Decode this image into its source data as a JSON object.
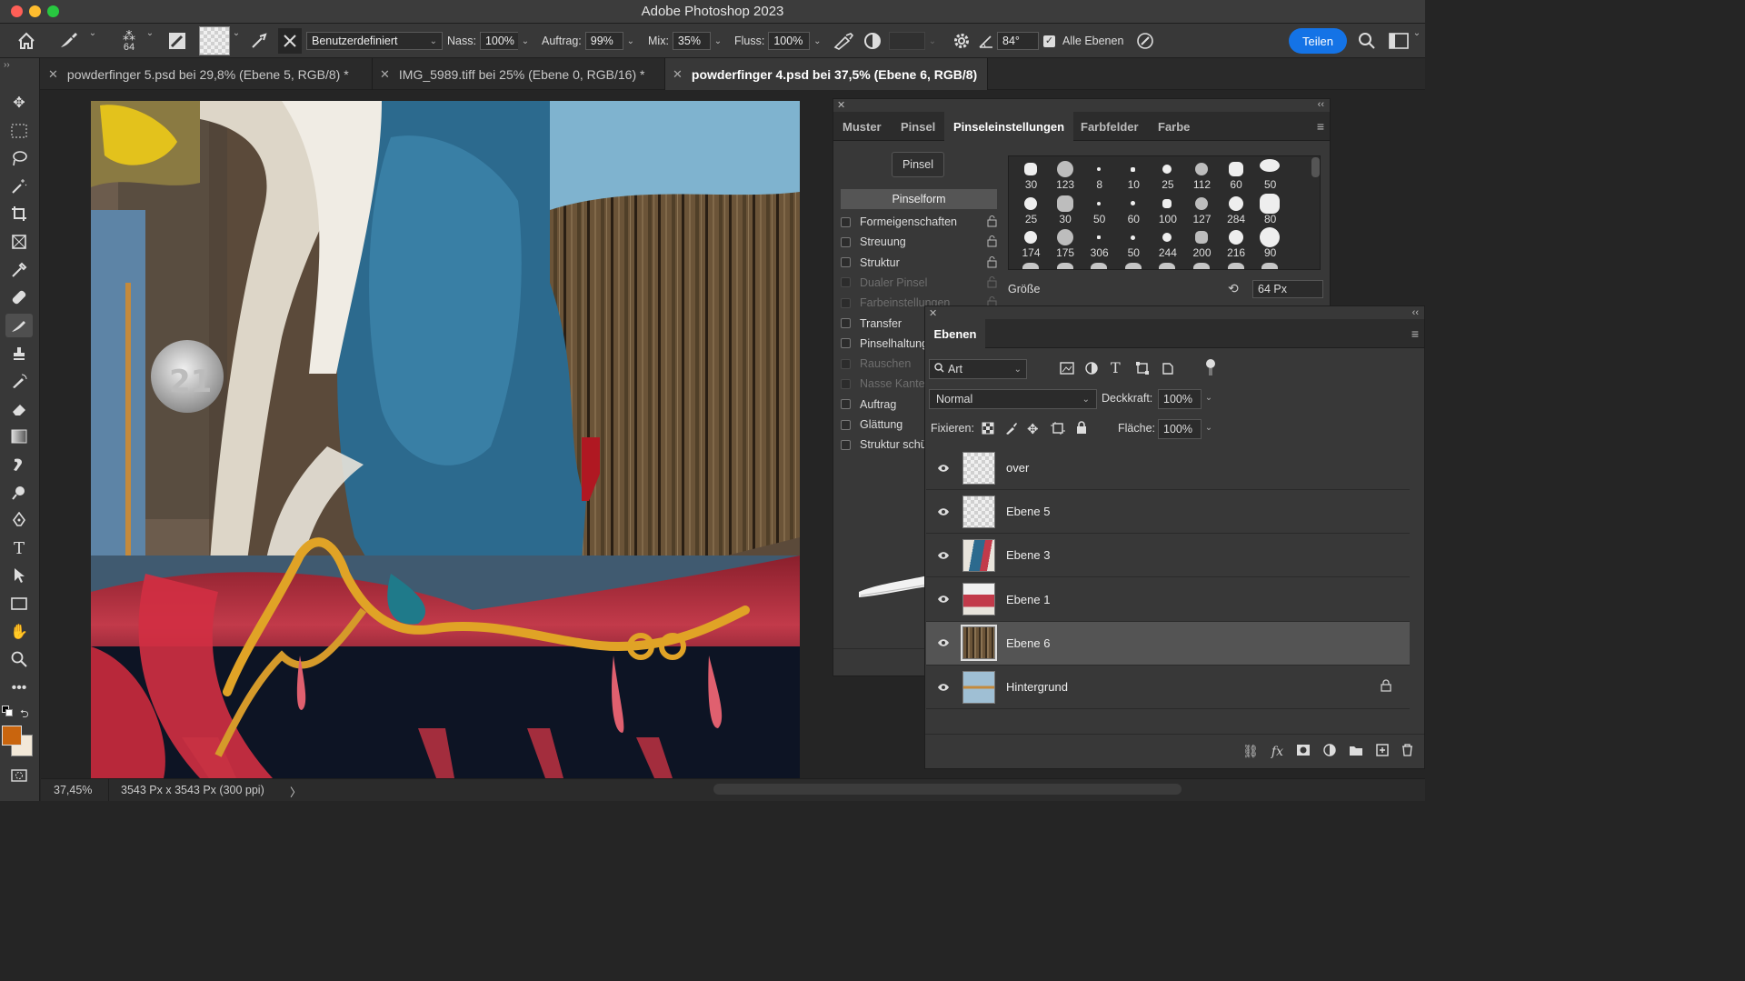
{
  "app": {
    "title": "Adobe Photoshop 2023"
  },
  "options": {
    "brush_size": "64",
    "preset": "Benutzerdefiniert",
    "wet_label": "Nass:",
    "wet_value": "100%",
    "load_label": "Auftrag:",
    "load_value": "99%",
    "mix_label": "Mix:",
    "mix_value": "35%",
    "flow_label": "Fluss:",
    "flow_value": "100%",
    "angle_value": "84°",
    "all_layers_label": "Alle Ebenen",
    "share_label": "Teilen"
  },
  "doc_tabs": [
    {
      "label": "powderfinger 5.psd bei 29,8% (Ebene 5, RGB/8) *",
      "active": false
    },
    {
      "label": "IMG_5989.tiff bei 25% (Ebene 0, RGB/16) *",
      "active": false
    },
    {
      "label": "powderfinger 4.psd bei 37,5% (Ebene 6, RGB/8)",
      "active": true
    }
  ],
  "status": {
    "zoom": "37,45%",
    "doc_info": "3543 Px x 3543 Px (300 ppi)",
    "arrow": "〉"
  },
  "brush_settings_panel": {
    "tabs": [
      "Muster",
      "Pinsel",
      "Pinseleinstellungen",
      "Farbfelder",
      "Farbe"
    ],
    "active_tab": "Pinseleinstellungen",
    "brush_button": "Pinsel",
    "section_header": "Pinselform",
    "options": [
      {
        "label": "Formeigenschaften",
        "enabled": true
      },
      {
        "label": "Streuung",
        "enabled": true
      },
      {
        "label": "Struktur",
        "enabled": true
      },
      {
        "label": "Dualer Pinsel",
        "enabled": false
      },
      {
        "label": "Farbeinstellungen",
        "enabled": false
      },
      {
        "label": "Transfer",
        "enabled": true
      },
      {
        "label": "Pinselhaltung",
        "enabled": true
      },
      {
        "label": "Rauschen",
        "enabled": false
      },
      {
        "label": "Nasse Kanten",
        "enabled": false
      },
      {
        "label": "Auftrag",
        "enabled": true
      },
      {
        "label": "Glättung",
        "enabled": true
      },
      {
        "label": "Struktur schützen",
        "enabled": true
      }
    ],
    "brush_tips": [
      "30",
      "123",
      "8",
      "10",
      "25",
      "112",
      "60",
      "50",
      "25",
      "30",
      "50",
      "60",
      "100",
      "127",
      "284",
      "80",
      "174",
      "175",
      "306",
      "50",
      "244",
      "200",
      "216",
      "90"
    ],
    "size_label": "Größe",
    "size_value": "64 Px"
  },
  "layers_panel": {
    "title": "Ebenen",
    "filter_kind": "Art",
    "blend_mode": "Normal",
    "opacity_label": "Deckkraft:",
    "opacity_value": "100%",
    "lock_label": "Fixieren:",
    "fill_label": "Fläche:",
    "fill_value": "100%",
    "layers": [
      {
        "name": "over",
        "selected": false,
        "locked": false,
        "thumb": "transparent"
      },
      {
        "name": "Ebene 5",
        "selected": false,
        "locked": false,
        "thumb": "transparent"
      },
      {
        "name": "Ebene 3",
        "selected": false,
        "locked": false,
        "thumb": "paint-blue-red"
      },
      {
        "name": "Ebene 1",
        "selected": false,
        "locked": false,
        "thumb": "paint-red"
      },
      {
        "name": "Ebene 6",
        "selected": true,
        "locked": false,
        "thumb": "wood"
      },
      {
        "name": "Hintergrund",
        "selected": false,
        "locked": true,
        "thumb": "sky"
      }
    ]
  },
  "colors": {
    "foreground": "#c9650e",
    "background": "#f2e8d8",
    "accent": "#1473e6"
  }
}
